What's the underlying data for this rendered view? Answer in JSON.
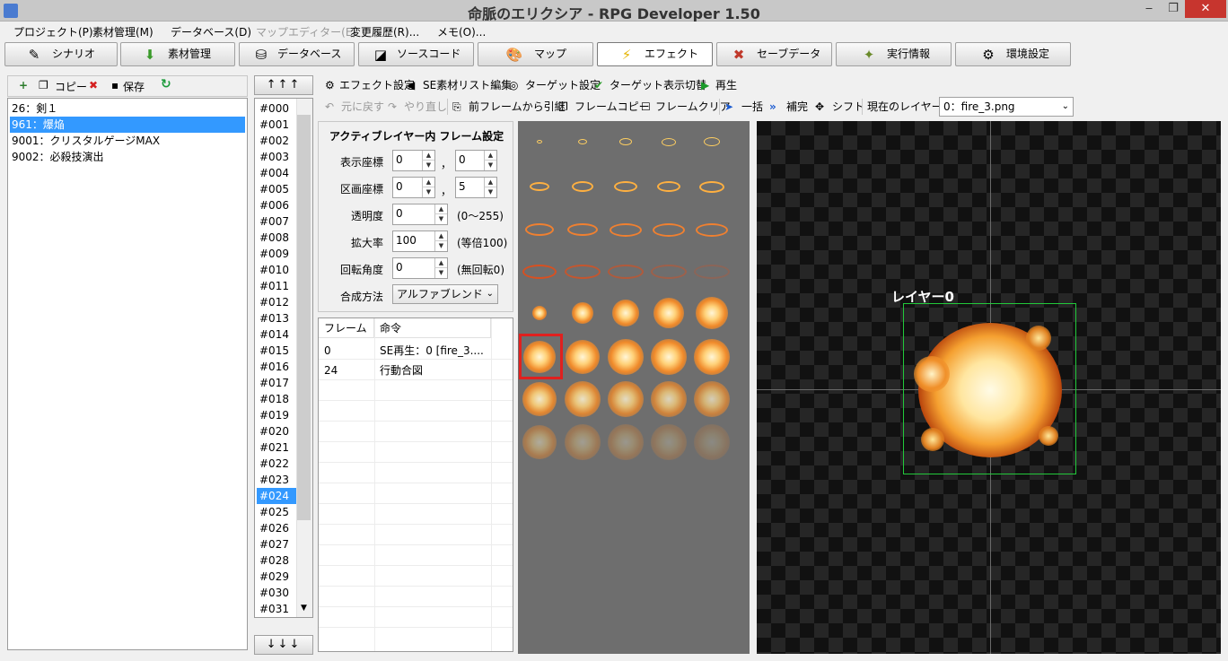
{
  "window": {
    "title": "命脈のエリクシア - RPG Developer 1.50",
    "minimize_glyph": "‒",
    "restore_glyph": "❐",
    "close_glyph": "✕"
  },
  "menubar": [
    "プロジェクト(P)",
    "素材管理(M)",
    "データベース(D)",
    "マップエディター(E)",
    "変更履歴(R)...",
    "メモ(O)..."
  ],
  "main_tabs": [
    {
      "label": "シナリオ",
      "icon": "pencil-icon",
      "glyph": "✎"
    },
    {
      "label": "素材管理",
      "icon": "download-box-icon",
      "glyph": "⬇"
    },
    {
      "label": "データベース",
      "icon": "database-icon",
      "glyph": "⛁"
    },
    {
      "label": "ソースコード",
      "icon": "code-icon",
      "glyph": "◪"
    },
    {
      "label": "マップ",
      "icon": "palette-icon",
      "glyph": "🎨"
    },
    {
      "label": "エフェクト",
      "icon": "lightning-icon",
      "glyph": "⚡"
    },
    {
      "label": "セーブデータ",
      "icon": "tools-icon",
      "glyph": "✖"
    },
    {
      "label": "実行情報",
      "icon": "wand-icon",
      "glyph": "✦"
    },
    {
      "label": "環境設定",
      "icon": "gear-icon",
      "glyph": "⚙"
    }
  ],
  "left_toolbar": {
    "copy": "コピー",
    "save": "保存",
    "new_glyph": "+",
    "copy_glyph": "❐",
    "delete_glyph": "✖",
    "save_glyph": "▪",
    "refresh_glyph": "↻"
  },
  "scenario_list": [
    "26：剣１",
    "961：爆焔",
    "9001：クリスタルゲージMAX",
    "9002：必殺技演出"
  ],
  "frame_nav": {
    "up": "↑↑↑",
    "down": "↓↓↓"
  },
  "frames": [
    "#000",
    "#001",
    "#002",
    "#003",
    "#004",
    "#005",
    "#006",
    "#007",
    "#008",
    "#009",
    "#010",
    "#011",
    "#012",
    "#013",
    "#014",
    "#015",
    "#016",
    "#017",
    "#018",
    "#019",
    "#020",
    "#021",
    "#022",
    "#023",
    "#024",
    "#025",
    "#026",
    "#027",
    "#028",
    "#029",
    "#030",
    "#031"
  ],
  "frame_scroll_down": "▼",
  "effect_toolbar1": {
    "effect_settings": "エフェクト設定",
    "se_list": "SE素材リスト編集",
    "target_settings": "ターゲット設定",
    "target_toggle": "ターゲット表示切替",
    "play": "再生",
    "g_settings": "⚙",
    "g_se": "◀",
    "g_target": "◎",
    "g_check": "✔",
    "g_play": "▶"
  },
  "effect_toolbar2": {
    "undo": "元に戻す",
    "redo": "やり直し",
    "from_prev": "前フレームから引継",
    "frame_copy": "フレームコピー",
    "frame_clear": "フレームクリア",
    "bulk": "一括",
    "interp": "補完",
    "shift": "シフト",
    "current_layer_label": "現在のレイヤー",
    "current_layer_value": "0：fire_3.png",
    "g_undo": "↶",
    "g_redo": "↷",
    "g_prev": "⎘",
    "g_copy": "❐",
    "g_clear": "☐",
    "g_bulk": "➤",
    "g_interp": "»",
    "g_shift": "✥",
    "caret": "⌄"
  },
  "settings": {
    "title": "アクティブレイヤー内 フレーム設定",
    "display_coord_label": "表示座標",
    "display_x": "0",
    "display_y": "0",
    "cell_coord_label": "区画座標",
    "cell_x": "0",
    "cell_y": "5",
    "comma": "，",
    "opacity_label": "透明度",
    "opacity": "0",
    "opacity_hint": "(0〜255)",
    "scale_label": "拡大率",
    "scale": "100",
    "scale_hint": "(等倍100)",
    "rotation_label": "回転角度",
    "rotation": "0",
    "rotation_hint": "(無回転0)",
    "blend_label": "合成方法",
    "blend": "アルファブレンド",
    "up": "▲",
    "down": "▼",
    "caret": "⌄"
  },
  "command_table": {
    "headers": [
      "フレーム",
      "命令"
    ],
    "rows": [
      {
        "frame": "0",
        "command": "SE再生：0 [fire_3...."
      },
      {
        "frame": "24",
        "command": "行動合図"
      }
    ]
  },
  "preview": {
    "layer_label": "レイヤー0"
  },
  "colors": {
    "selection": "#3399ff",
    "sprite_bg": "#6e6e6e",
    "layer_box": "#22c93a",
    "selected_cell": "#e0201e",
    "close": "#c7352e"
  }
}
